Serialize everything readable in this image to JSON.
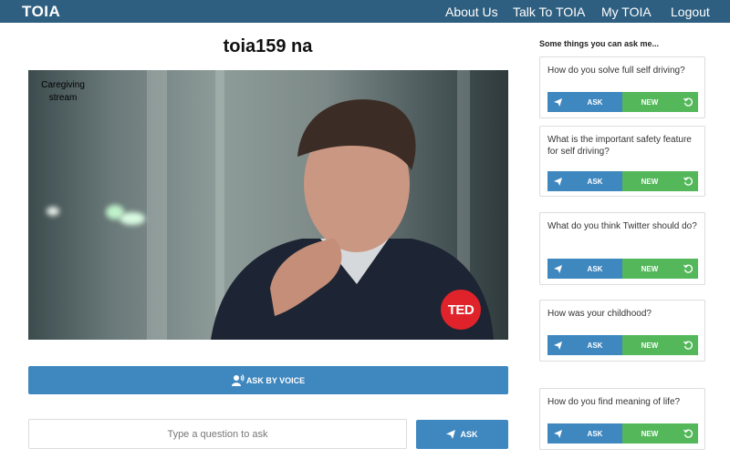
{
  "nav": {
    "brand": "TOIA",
    "links": [
      "About Us",
      "Talk To TOIA",
      "My TOIA",
      "Logout"
    ]
  },
  "page_title": "toia159 na",
  "video": {
    "stream_label": "Caregiving stream",
    "badge": "TED"
  },
  "voice_button": "ASK BY VOICE",
  "question_input": {
    "placeholder": "Type a question to ask",
    "value": ""
  },
  "ask_button": "ASK",
  "suggestions": {
    "heading": "Some things you can ask me...",
    "ask_label": "ASK",
    "new_label": "NEW",
    "items": [
      "How do you solve full self driving?",
      "What is the important safety feature for self driving?",
      "What do you think Twitter should do?",
      "How was your childhood?",
      "How do you find meaning of life?"
    ]
  },
  "colors": {
    "navbar": "#2f5f80",
    "primary_blue": "#3f87bf",
    "green": "#54b85b",
    "ted_red": "#e0232a"
  },
  "icons": [
    "paper-plane-icon",
    "voice-icon",
    "refresh-icon"
  ]
}
